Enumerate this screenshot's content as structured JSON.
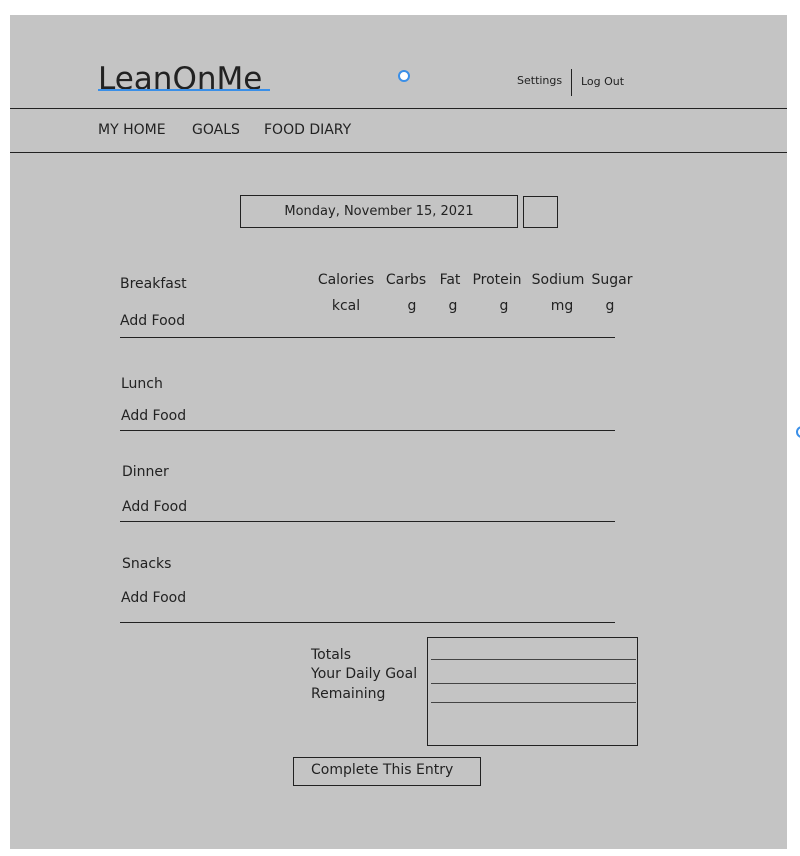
{
  "app": {
    "logo": "LeanOnMe",
    "settings_label": "Settings",
    "logout_label": "Log Out"
  },
  "nav": {
    "items": [
      "MY HOME",
      "GOALS",
      "FOOD DIARY"
    ]
  },
  "date": {
    "label": "Monday, November 15, 2021"
  },
  "columns": [
    {
      "label": "Calories",
      "unit": "kcal"
    },
    {
      "label": "Carbs",
      "unit": "g"
    },
    {
      "label": "Fat",
      "unit": "g"
    },
    {
      "label": "Protein",
      "unit": "g"
    },
    {
      "label": "Sodium",
      "unit": "mg"
    },
    {
      "label": "Sugar",
      "unit": "g"
    }
  ],
  "meals": [
    {
      "name": "Breakfast",
      "add_label": "Add Food"
    },
    {
      "name": "Lunch",
      "add_label": "Add Food"
    },
    {
      "name": "Dinner",
      "add_label": "Add Food"
    },
    {
      "name": "Snacks",
      "add_label": "Add Food"
    }
  ],
  "summary": {
    "totals_label": "Totals",
    "goal_label": "Your Daily Goal",
    "remaining_label": "Remaining"
  },
  "complete_label": "Complete This Entry",
  "colors": {
    "background": "#c4c4c4",
    "accent": "#3a8fe8"
  }
}
